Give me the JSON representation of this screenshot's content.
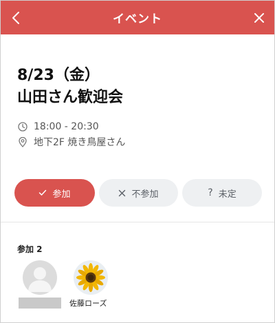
{
  "header": {
    "title": "イベント",
    "bg_color": "#d9534f",
    "back_icon": "chevron-left-icon",
    "close_icon": "close-icon"
  },
  "event": {
    "date": "8/23（金）",
    "name": "山田さん歓迎会",
    "time": "18:00 - 20:30",
    "location": "地下2F 焼き鳥屋さん",
    "time_icon": "clock-icon",
    "location_icon": "map-pin-icon"
  },
  "rsvp": {
    "attend_label": "参加",
    "decline_label": "不参加",
    "undecided_label": "未定",
    "attend_color": "#d9534f",
    "selected": "attend"
  },
  "attendees": {
    "heading": "参加 2",
    "people": [
      {
        "name": "",
        "avatar": "default-user-avatar",
        "name_redacted": true
      },
      {
        "name": "佐藤ローズ",
        "avatar": "sunflower-avatar"
      }
    ]
  }
}
